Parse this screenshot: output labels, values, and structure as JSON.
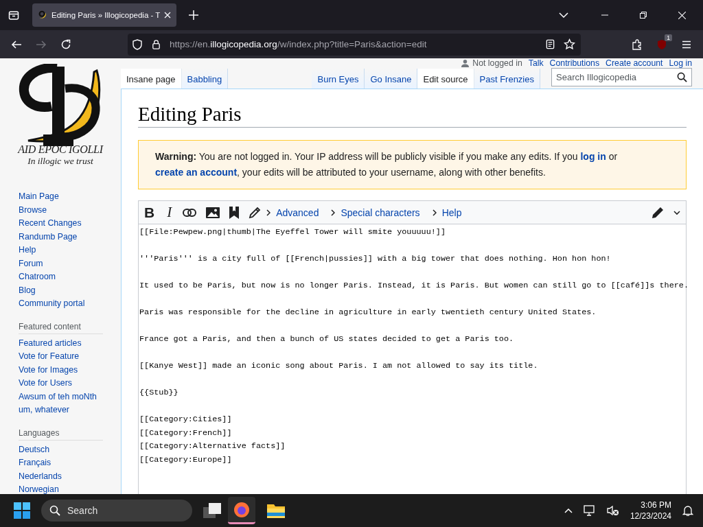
{
  "browser": {
    "tab_title": "Editing Paris » Illogicopedia - T",
    "url_prefix": "https://en.",
    "url_domain": "illogicopedia.org",
    "url_path": "/w/index.php?title=Paris&action=edit",
    "extension_badge": "1"
  },
  "logo": {
    "wordmark": "AID EPOC IGOLLI",
    "motto": "In illogic we trust"
  },
  "sidebar": {
    "navigation": [
      "Main Page",
      "Browse",
      "Recent Changes",
      "Randumb Page",
      "Help",
      "Forum",
      "Chatroom",
      "Blog",
      "Community portal"
    ],
    "sections": [
      {
        "heading": "Featured content",
        "items": [
          "Featured articles",
          "Vote for Feature",
          "Vote for Images",
          "Vote for Users",
          "Awsum of teh moNth um, whatever"
        ]
      },
      {
        "heading": "Languages",
        "items": [
          "Deutsch",
          "Français",
          "Nederlands",
          "Norwegian"
        ]
      }
    ]
  },
  "personal_tools": {
    "status": "Not logged in",
    "links": [
      "Talk",
      "Contributions",
      "Create account",
      "Log in"
    ]
  },
  "namespace_tabs": [
    {
      "label": "Insane page",
      "selected": true
    },
    {
      "label": "Babbling",
      "selected": false
    }
  ],
  "view_tabs": [
    {
      "label": "Burn Eyes",
      "selected": false
    },
    {
      "label": "Go Insane",
      "selected": false
    },
    {
      "label": "Edit source",
      "selected": true
    },
    {
      "label": "Past Frenzies",
      "selected": false
    }
  ],
  "search": {
    "placeholder": "Search Illogicopedia"
  },
  "heading": "Editing Paris",
  "warning": {
    "label": "Warning:",
    "text_1": "You are not logged in. Your IP address will be publicly visible if you make any edits. If you",
    "link_1": "log in",
    "text_2": "or",
    "link_2": "create an account",
    "text_3": ", your edits will be attributed to your username, along with other benefits."
  },
  "editor": {
    "format_buttons": [
      "B",
      "I"
    ],
    "sections": [
      "Advanced",
      "Special characters",
      "Help"
    ],
    "paragraphs": [
      [
        "[[File:Pewpew.png|thumb|The Eyeffel Tower will smite youuuuu!]]"
      ],
      [
        "'''Paris''' is a city full of [[French|pussies]] with a big tower that does nothing. Hon hon hon!"
      ],
      [
        "It used to be Paris, but now is no longer Paris. Instead, it is Paris. But women can still go to [[café]]s there."
      ],
      [
        "Paris was responsible for the decline in agriculture in early twentieth century United States."
      ],
      [
        "France got a Paris, and then a bunch of US states decided to get a Paris too."
      ],
      [
        "[[Kanye West]] made an iconic song about Paris. I am not allowed to say its title."
      ],
      [
        "{{Stub}}"
      ],
      [
        "[[Category:Cities]]",
        "[[Category:French]]",
        "[[Category:Alternative facts]]",
        "[[Category:Europe]]"
      ]
    ]
  },
  "taskbar": {
    "search_placeholder": "Search",
    "time": "3:06 PM",
    "date": "12/23/2024"
  }
}
